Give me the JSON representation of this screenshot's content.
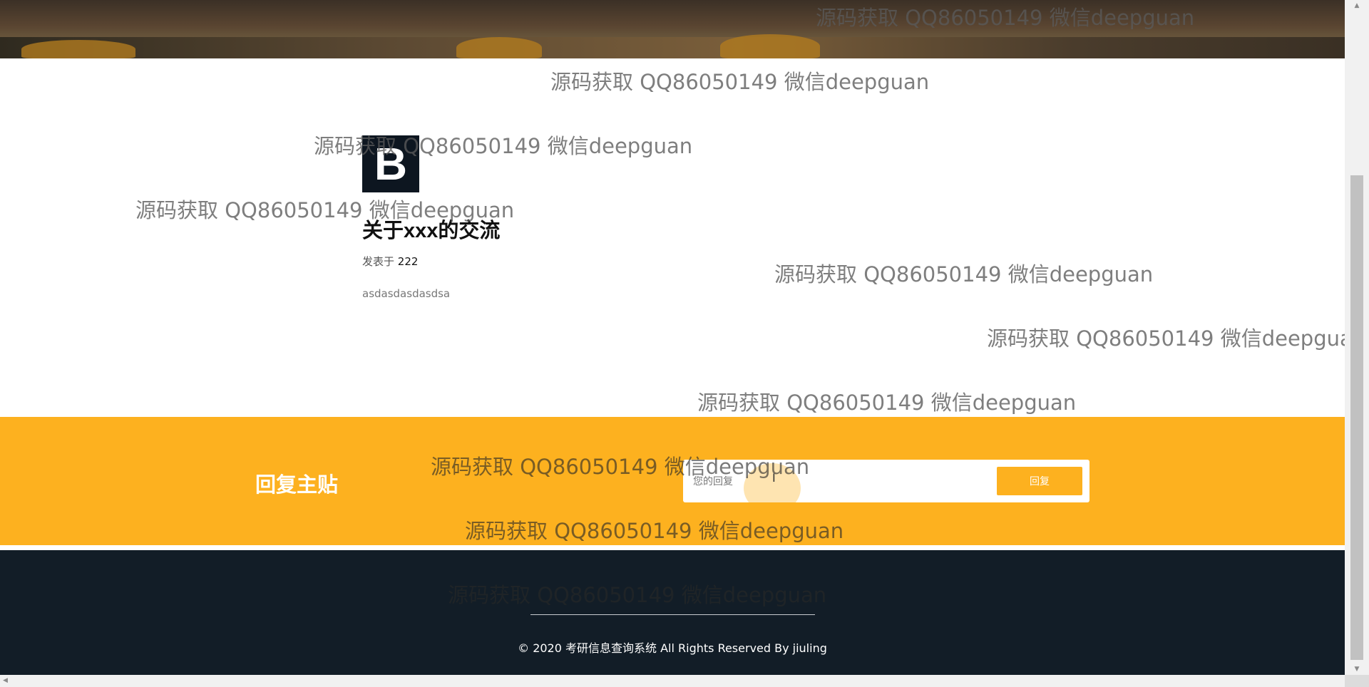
{
  "post": {
    "logo_letter": "B",
    "title": "关于xxx的交流",
    "meta_label": "发表于",
    "meta_value": "222",
    "body": "asdasdasdasdsa"
  },
  "reply": {
    "title": "回复主贴",
    "input_placeholder": "您的回复",
    "submit_label": "回复"
  },
  "footer": {
    "copyright": "© 2020 考研信息查询系统 All Rights Reserved By jiuling"
  },
  "watermark": {
    "text": "源码获取 QQ86050149 微信deepguan"
  },
  "colors": {
    "accent": "#fdb11f",
    "footer_bg": "#121d27",
    "logo_bg": "#0d1620"
  }
}
